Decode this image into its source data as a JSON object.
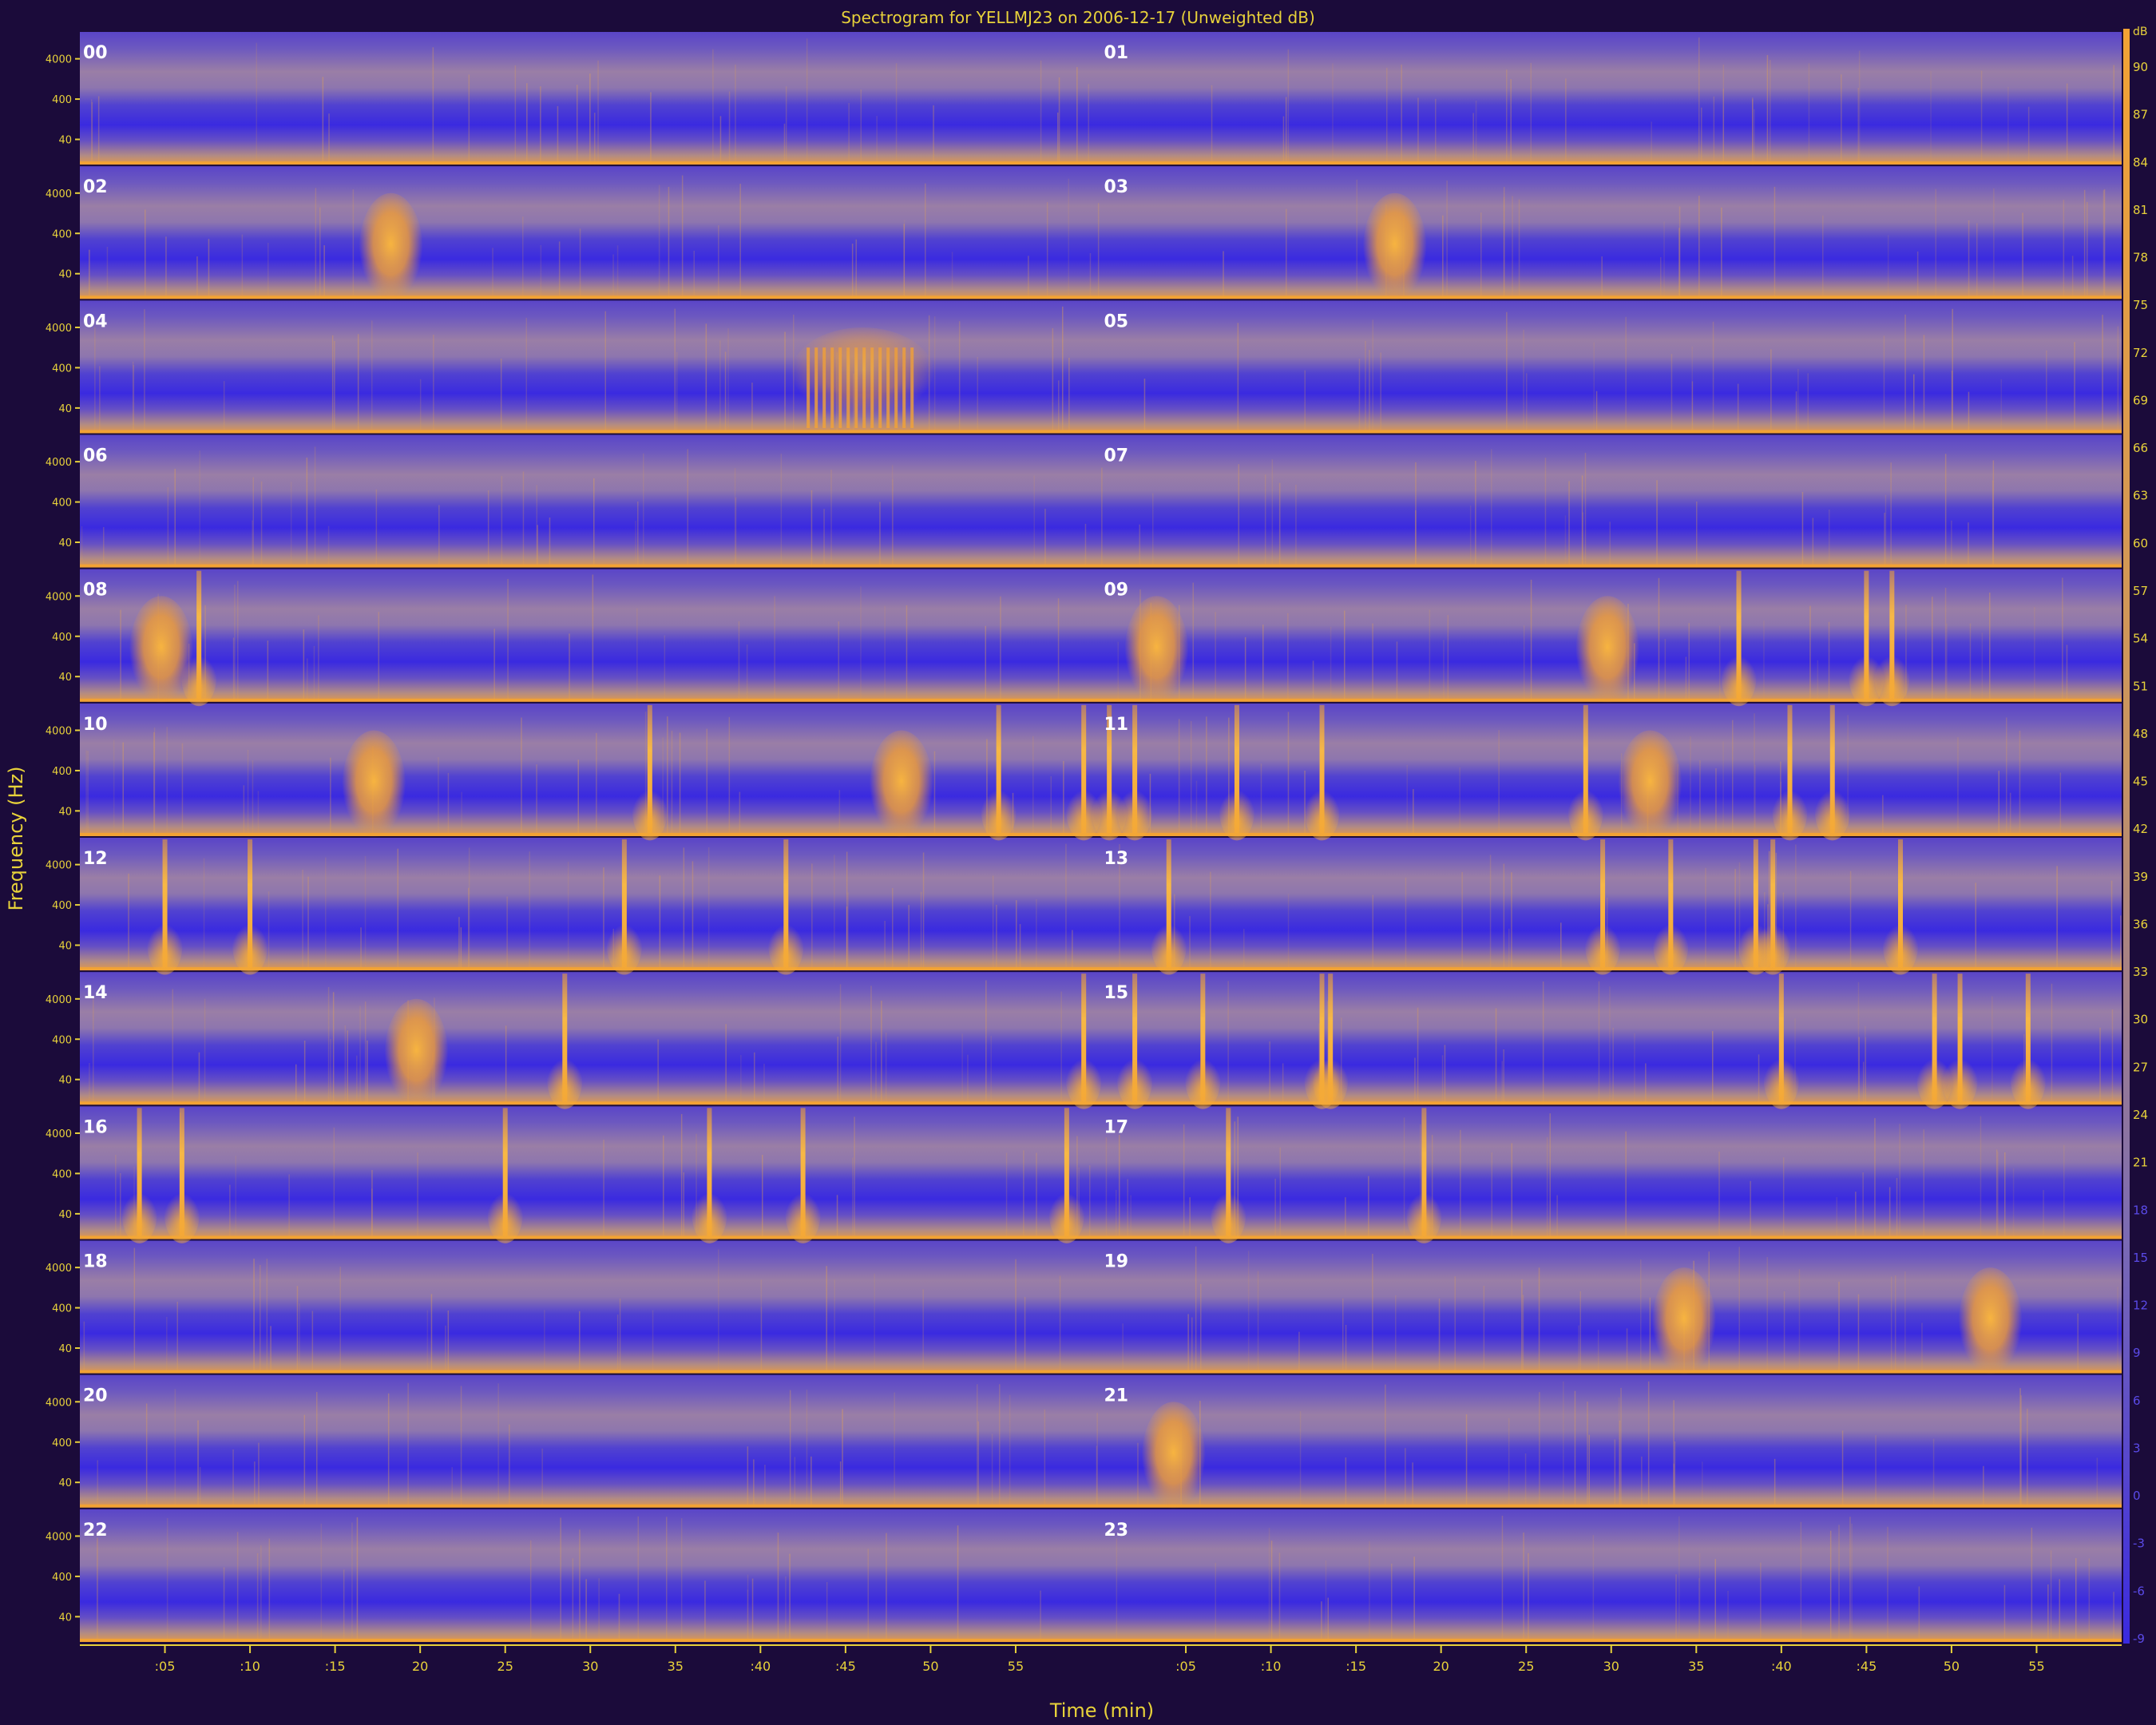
{
  "chart_data": {
    "type": "heatmap",
    "title": "Spectrogram for YELLMJ23 on 2006-12-17 (Unweighted dB)",
    "xlabel": "Time (min)",
    "ylabel": "Frequency (Hz)",
    "rows": 12,
    "halves_per_row": 2,
    "panel_labels": [
      "00",
      "01",
      "02",
      "03",
      "04",
      "05",
      "06",
      "07",
      "08",
      "09",
      "10",
      "11",
      "12",
      "13",
      "14",
      "15",
      "16",
      "17",
      "18",
      "19",
      "20",
      "21",
      "22",
      "23"
    ],
    "x_tick_labels": [
      ":05",
      ":10",
      ":15",
      "20",
      "25",
      "30",
      "35",
      ":40",
      ":45",
      "50",
      "55"
    ],
    "y_tick_labels": [
      "4000",
      "400",
      "40"
    ],
    "colorbar": {
      "unit": "dB",
      "ticks": [
        90,
        87,
        84,
        81,
        78,
        75,
        72,
        69,
        66,
        63,
        60,
        57,
        54,
        51,
        48,
        45,
        42,
        39,
        36,
        33,
        30,
        27,
        24,
        21,
        18,
        15,
        12,
        9,
        6,
        3,
        0,
        -3,
        -6,
        -9
      ]
    },
    "colors": {
      "background": "#1b0b3a",
      "low_energy": "#3a2ae0",
      "mid_energy": "#8a73a8",
      "high_energy": "#f2a234",
      "text": "#e8d23a",
      "panel_label": "#ffffff"
    },
    "events": [
      {
        "hour": "02",
        "minute": 18.0,
        "type": "blob"
      },
      {
        "hour": "03",
        "minute": 17.0,
        "type": "blob"
      },
      {
        "hour": "04",
        "minute": 46.0,
        "type": "burst"
      },
      {
        "hour": "08",
        "minute": 4.5,
        "type": "blob"
      },
      {
        "hour": "08",
        "minute": 7.0,
        "type": "spike"
      },
      {
        "hour": "09",
        "minute": 3.0,
        "type": "blob"
      },
      {
        "hour": "09",
        "minute": 29.5,
        "type": "blob"
      },
      {
        "hour": "09",
        "minute": 37.5,
        "type": "spike"
      },
      {
        "hour": "09",
        "minute": 45.0,
        "type": "spike"
      },
      {
        "hour": "09",
        "minute": 46.5,
        "type": "spike"
      },
      {
        "hour": "10",
        "minute": 17.0,
        "type": "blob"
      },
      {
        "hour": "10",
        "minute": 33.5,
        "type": "spike"
      },
      {
        "hour": "10",
        "minute": 48.0,
        "type": "blob"
      },
      {
        "hour": "10",
        "minute": 54.0,
        "type": "spike"
      },
      {
        "hour": "10",
        "minute": 59.0,
        "type": "spike"
      },
      {
        "hour": "11",
        "minute": 0.5,
        "type": "spike"
      },
      {
        "hour": "11",
        "minute": 2.0,
        "type": "spike"
      },
      {
        "hour": "11",
        "minute": 8.0,
        "type": "spike"
      },
      {
        "hour": "11",
        "minute": 13.0,
        "type": "spike"
      },
      {
        "hour": "11",
        "minute": 28.5,
        "type": "spike"
      },
      {
        "hour": "11",
        "minute": 32.0,
        "type": "blob"
      },
      {
        "hour": "11",
        "minute": 40.5,
        "type": "spike"
      },
      {
        "hour": "11",
        "minute": 43.0,
        "type": "spike"
      },
      {
        "hour": "12",
        "minute": 5.0,
        "type": "spike"
      },
      {
        "hour": "12",
        "minute": 10.0,
        "type": "spike"
      },
      {
        "hour": "12",
        "minute": 32.0,
        "type": "spike"
      },
      {
        "hour": "12",
        "minute": 41.5,
        "type": "spike"
      },
      {
        "hour": "13",
        "minute": 4.0,
        "type": "spike"
      },
      {
        "hour": "13",
        "minute": 29.5,
        "type": "spike"
      },
      {
        "hour": "13",
        "minute": 33.5,
        "type": "spike"
      },
      {
        "hour": "13",
        "minute": 38.5,
        "type": "spike"
      },
      {
        "hour": "13",
        "minute": 39.5,
        "type": "spike"
      },
      {
        "hour": "13",
        "minute": 47.0,
        "type": "spike"
      },
      {
        "hour": "14",
        "minute": 19.5,
        "type": "blob"
      },
      {
        "hour": "14",
        "minute": 28.5,
        "type": "spike"
      },
      {
        "hour": "14",
        "minute": 59.0,
        "type": "spike"
      },
      {
        "hour": "15",
        "minute": 2.0,
        "type": "spike"
      },
      {
        "hour": "15",
        "minute": 6.0,
        "type": "spike"
      },
      {
        "hour": "15",
        "minute": 13.0,
        "type": "spike"
      },
      {
        "hour": "15",
        "minute": 13.5,
        "type": "spike"
      },
      {
        "hour": "15",
        "minute": 40.0,
        "type": "spike"
      },
      {
        "hour": "15",
        "minute": 49.0,
        "type": "spike"
      },
      {
        "hour": "15",
        "minute": 50.5,
        "type": "spike"
      },
      {
        "hour": "15",
        "minute": 54.5,
        "type": "spike"
      },
      {
        "hour": "16",
        "minute": 3.5,
        "type": "spike"
      },
      {
        "hour": "16",
        "minute": 6.0,
        "type": "spike"
      },
      {
        "hour": "16",
        "minute": 25.0,
        "type": "spike"
      },
      {
        "hour": "16",
        "minute": 37.0,
        "type": "spike"
      },
      {
        "hour": "16",
        "minute": 42.5,
        "type": "spike"
      },
      {
        "hour": "16",
        "minute": 58.0,
        "type": "spike"
      },
      {
        "hour": "17",
        "minute": 7.5,
        "type": "spike"
      },
      {
        "hour": "17",
        "minute": 19.0,
        "type": "spike"
      },
      {
        "hour": "19",
        "minute": 34.0,
        "type": "blob"
      },
      {
        "hour": "19",
        "minute": 52.0,
        "type": "blob"
      },
      {
        "hour": "21",
        "minute": 4.0,
        "type": "blob"
      }
    ]
  }
}
